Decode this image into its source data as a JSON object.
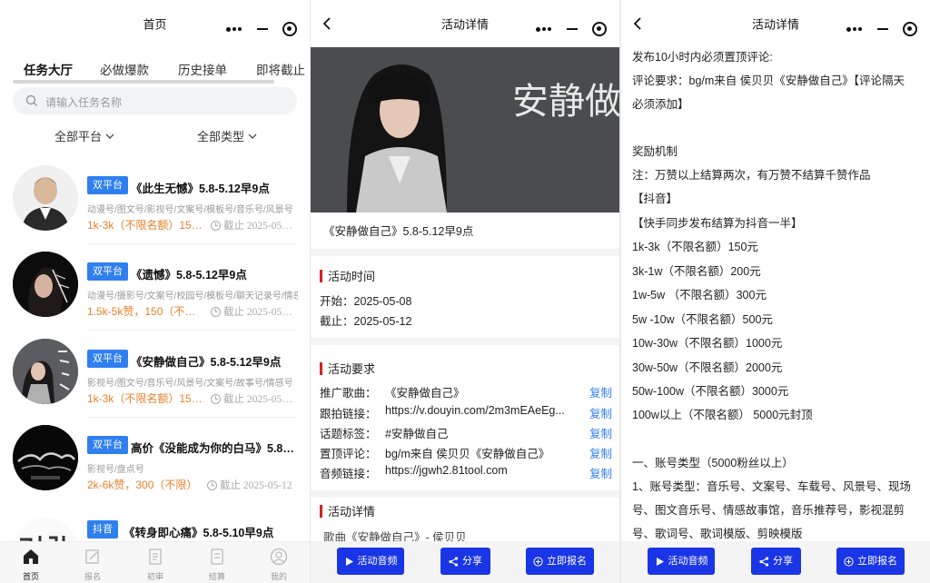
{
  "home": {
    "title": "首页",
    "tabs": [
      "任务大厅",
      "必做爆款",
      "历史接单",
      "即将截止"
    ],
    "search_placeholder": "请输入任务名称",
    "filters": [
      "全部平台",
      "全部类型"
    ],
    "tasks": [
      {
        "badge": "双平台",
        "title": "《此生无憾》5.8-5.12早9点",
        "tags": "动漫号/图文号/影视号/文案号/模板号/音乐号/风景号",
        "price": "1k-3k（不限名额）15…",
        "deadline": "截止 2025-05…"
      },
      {
        "badge": "双平台",
        "title": "《遗憾》5.8-5.12早9点",
        "tags": "动漫号/摄影号/文案号/校园号/模板号/聊天记录号/情感号",
        "price": "1.5k-5k赞，150（不…",
        "deadline": "截止 2025-05…"
      },
      {
        "badge": "双平台",
        "title": "《安静做自己》5.8-5.12早9点",
        "tags": "影视号/图文号/音乐号/风景号/文案号/故事号/情感号",
        "price": "1k-3k（不限名额）15…",
        "deadline": "截止 2025-05…"
      },
      {
        "badge": "双平台",
        "title": "高价《没能成为你的白马》5.8…",
        "tags": "影视号/盘点号",
        "price": "2k-6k赞，300（不限）",
        "deadline": "截止 2025-05-12"
      },
      {
        "badge": "抖音",
        "title": "《转身即心痛》5.8-5.10早9点",
        "tags": "",
        "price": "",
        "deadline": ""
      }
    ],
    "tabbar": [
      "首页",
      "报名",
      "初审",
      "结算",
      "我的"
    ]
  },
  "detail": {
    "title": "活动详情",
    "hero_text": "安静做",
    "activity_title": "《安静做自己》5.8-5.12早9点",
    "time_heading": "活动时间",
    "start": "开始：2025-05-08",
    "end": "截止：2025-05-12",
    "req_heading": "活动要求",
    "requirements": [
      {
        "label": "推广歌曲：",
        "value": "《安静做自己》",
        "copy": "复制"
      },
      {
        "label": "跟拍链接：",
        "value": "https://v.douyin.com/2m3mEAeEg...",
        "copy": "复制"
      },
      {
        "label": "话题标签：",
        "value": "#安静做自己",
        "copy": "复制"
      },
      {
        "label": "置顶评论：",
        "value": "bg/m来自 侯贝贝《安静做自己》",
        "copy": "复制"
      },
      {
        "label": "音频链接：",
        "value": "https://jgwh2.81tool.com",
        "copy": "复制"
      }
    ],
    "detail_heading": "活动详情",
    "song_line": "歌曲《安静做自己》- 侯贝贝",
    "buttons": [
      "活动音频",
      "分享",
      "立即报名"
    ]
  },
  "detail2": {
    "title": "活动详情",
    "lines": [
      "发布10小时内必须置顶评论:",
      "评论要求：bg/m来自 侯贝贝《安静做自己》【评论隔天",
      "必须添加】",
      "",
      "奖励机制",
      "注：万赞以上结算两次，有万赞不结算千赞作品",
      "【抖音】",
      "【快手同步发布结算为抖音一半】",
      "1k-3k（不限名额）150元",
      "3k-1w（不限名额）200元",
      "1w-5w （不限名额）300元",
      "5w -10w（不限名额）500元",
      "10w-30w（不限名额）1000元",
      "30w-50w（不限名额）2000元",
      "50w-100w（不限名额）3000元",
      "100w以上（不限名额） 5000元封顶",
      "",
      "",
      "一、账号类型（5000粉丝以上）",
      "1、账号类型：音乐号、文案号、车载号、风景号、现场",
      "号、图文音乐号、情感故事馆，音乐推荐号，影视混剪",
      "号、歌词号、歌词模版、剪映模版"
    ],
    "buttons": [
      "活动音频",
      "分享",
      "立即报名"
    ]
  }
}
